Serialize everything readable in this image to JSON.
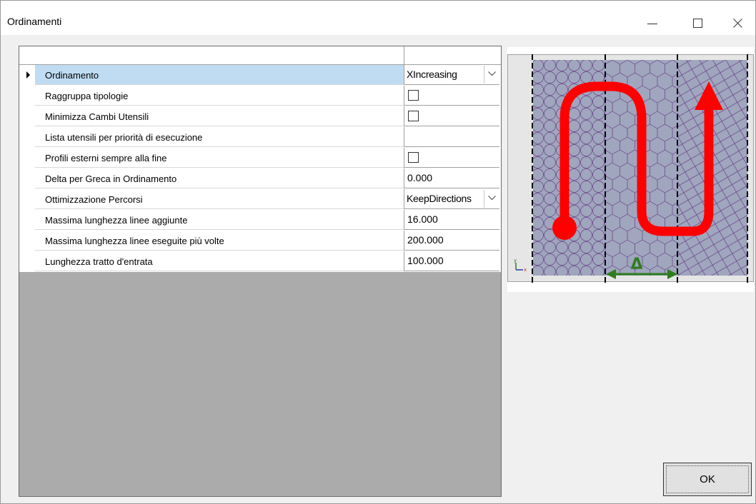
{
  "window": {
    "title": "Ordinamenti"
  },
  "grid": {
    "rows": [
      {
        "label": "Ordinamento",
        "value": "XIncreasing",
        "type": "combo",
        "selected": true
      },
      {
        "label": "Raggruppa tipologie",
        "value": "",
        "type": "checkbox",
        "checked": false
      },
      {
        "label": "Minimizza Cambi Utensili",
        "value": "",
        "type": "checkbox",
        "checked": false
      },
      {
        "label": "Lista utensili per priorità di esecuzione",
        "value": "",
        "type": "empty"
      },
      {
        "label": "Profili esterni sempre alla fine",
        "value": "",
        "type": "checkbox",
        "checked": false
      },
      {
        "label": "Delta per Greca in Ordinamento",
        "value": "0.000",
        "type": "text"
      },
      {
        "label": "Ottimizzazione Percorsi",
        "value": "KeepDirections",
        "type": "combo"
      },
      {
        "label": "Massima lunghezza linee aggiunte",
        "value": "16.000",
        "type": "text"
      },
      {
        "label": "Massima lunghezza linee eseguite più volte",
        "value": "200.000",
        "type": "text"
      },
      {
        "label": "Lunghezza tratto d'entrata",
        "value": "100.000",
        "type": "text"
      }
    ]
  },
  "illustration": {
    "delta_symbol": "Δ",
    "axis_y": "y",
    "axis_x": "x",
    "path_color": "#ff0000",
    "delta_color": "#2e7d1e",
    "fill_color": "#9fa6bd",
    "cell_stroke": "#6a3d8a"
  },
  "buttons": {
    "ok_label": "OK"
  },
  "icons": {
    "minimize": "minimize-icon",
    "maximize": "maximize-icon",
    "close": "close-icon",
    "row_pointer": "row-pointer-icon",
    "dropdown": "chevron-down-icon"
  }
}
